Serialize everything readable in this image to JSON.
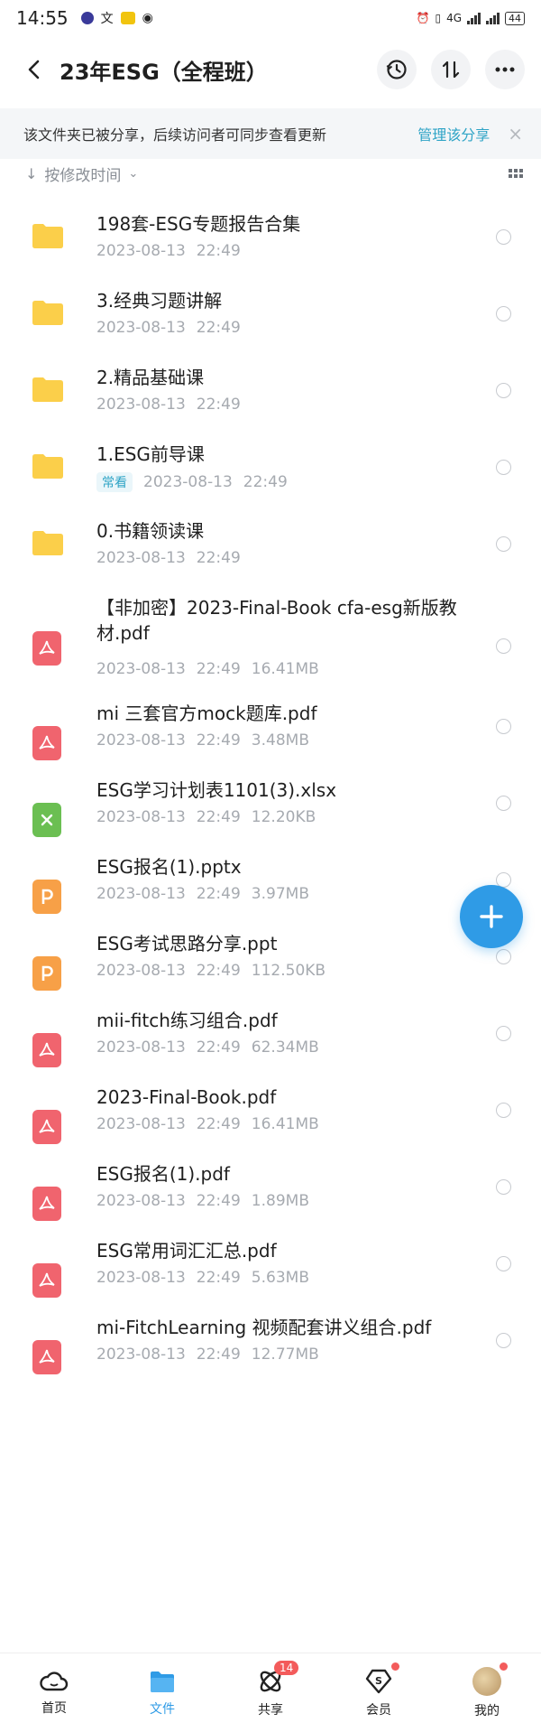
{
  "status_bar": {
    "time": "14:55",
    "network_label": "4G",
    "battery": "44"
  },
  "header": {
    "title": "23年ESG（全程班）"
  },
  "banner": {
    "text": "该文件夹已被分享，后续访问者可同步查看更新",
    "link": "管理该分享",
    "close": "×"
  },
  "sort": {
    "label": "按修改时间"
  },
  "files": [
    {
      "name": "198套-ESG专题报告合集",
      "date": "2023-08-13",
      "time": "22:49",
      "size": "",
      "type": "folder",
      "tag": ""
    },
    {
      "name": "3.经典习题讲解",
      "date": "2023-08-13",
      "time": "22:49",
      "size": "",
      "type": "folder",
      "tag": ""
    },
    {
      "name": "2.精品基础课",
      "date": "2023-08-13",
      "time": "22:49",
      "size": "",
      "type": "folder",
      "tag": ""
    },
    {
      "name": "1.ESG前导课",
      "date": "2023-08-13",
      "time": "22:49",
      "size": "",
      "type": "folder",
      "tag": "常看"
    },
    {
      "name": "0.书籍领读课",
      "date": "2023-08-13",
      "time": "22:49",
      "size": "",
      "type": "folder",
      "tag": ""
    },
    {
      "name": "【非加密】2023-Final-Book cfa-esg新版教材.pdf",
      "date": "2023-08-13",
      "time": "22:49",
      "size": "16.41MB",
      "type": "pdf",
      "tag": ""
    },
    {
      "name": "mi 三套官方mock题库.pdf",
      "date": "2023-08-13",
      "time": "22:49",
      "size": "3.48MB",
      "type": "pdf",
      "tag": ""
    },
    {
      "name": "ESG学习计划表1101(3).xlsx",
      "date": "2023-08-13",
      "time": "22:49",
      "size": "12.20KB",
      "type": "xlsx",
      "tag": ""
    },
    {
      "name": "ESG报名(1).pptx",
      "date": "2023-08-13",
      "time": "22:49",
      "size": "3.97MB",
      "type": "ppt",
      "tag": ""
    },
    {
      "name": "ESG考试思路分享.ppt",
      "date": "2023-08-13",
      "time": "22:49",
      "size": "112.50KB",
      "type": "ppt",
      "tag": ""
    },
    {
      "name": "mii-fitch练习组合.pdf",
      "date": "2023-08-13",
      "time": "22:49",
      "size": "62.34MB",
      "type": "pdf",
      "tag": ""
    },
    {
      "name": "2023-Final-Book.pdf",
      "date": "2023-08-13",
      "time": "22:49",
      "size": "16.41MB",
      "type": "pdf",
      "tag": ""
    },
    {
      "name": "ESG报名(1).pdf",
      "date": "2023-08-13",
      "time": "22:49",
      "size": "1.89MB",
      "type": "pdf",
      "tag": ""
    },
    {
      "name": "ESG常用词汇汇总.pdf",
      "date": "2023-08-13",
      "time": "22:49",
      "size": "5.63MB",
      "type": "pdf",
      "tag": ""
    },
    {
      "name": "mi-FitchLearning 视频配套讲义组合.pdf",
      "date": "2023-08-13",
      "time": "22:49",
      "size": "12.77MB",
      "type": "pdf",
      "tag": ""
    }
  ],
  "bottom_nav": {
    "home": "首页",
    "files": "文件",
    "share": "共享",
    "share_badge": "14",
    "vip": "会员",
    "me": "我的"
  },
  "colors": {
    "accent": "#2f9be6",
    "link": "#2fa4c6",
    "folder": "#fbcf4a",
    "pdf": "#f0646e",
    "xlsx": "#6bbf52",
    "ppt": "#f7a047"
  }
}
